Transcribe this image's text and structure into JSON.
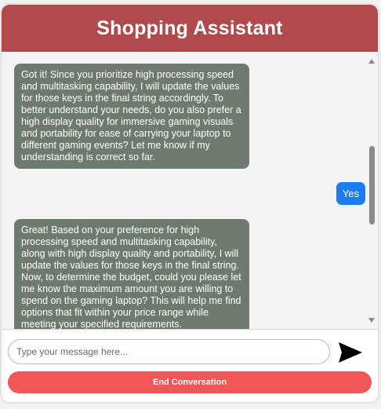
{
  "header": {
    "title": "Shopping Assistant"
  },
  "colors": {
    "header_bg": "#b04a4c",
    "bot_bubble": "#6f7a6e",
    "user_bubble": "#1c7cf2",
    "end_button": "#f25656"
  },
  "messages": [
    {
      "role": "assistant",
      "text": "Got it! Since you prioritize high processing speed and multitasking capability, I will update the values for those keys in the final string accordingly. To better understand your needs, do you also prefer a high display quality for immersive gaming visuals and portability for ease of carrying your laptop to different gaming events? Let me know if my understanding is correct so far."
    },
    {
      "role": "user",
      "text": "Yes"
    },
    {
      "role": "assistant",
      "text": "Great! Based on your preference for high processing speed and multitasking capability, along with high display quality and portability, I will update the values for those keys in the final string. Now, to determine the budget, could you please let me know the maximum amount you are willing to spend on the gaming laptop? This will help me find options that fit within your price range while meeting your specified requirements."
    }
  ],
  "composer": {
    "placeholder": "Type your message here...",
    "send_icon": "send-arrow-icon"
  },
  "end_button": {
    "label": "End Conversation"
  }
}
